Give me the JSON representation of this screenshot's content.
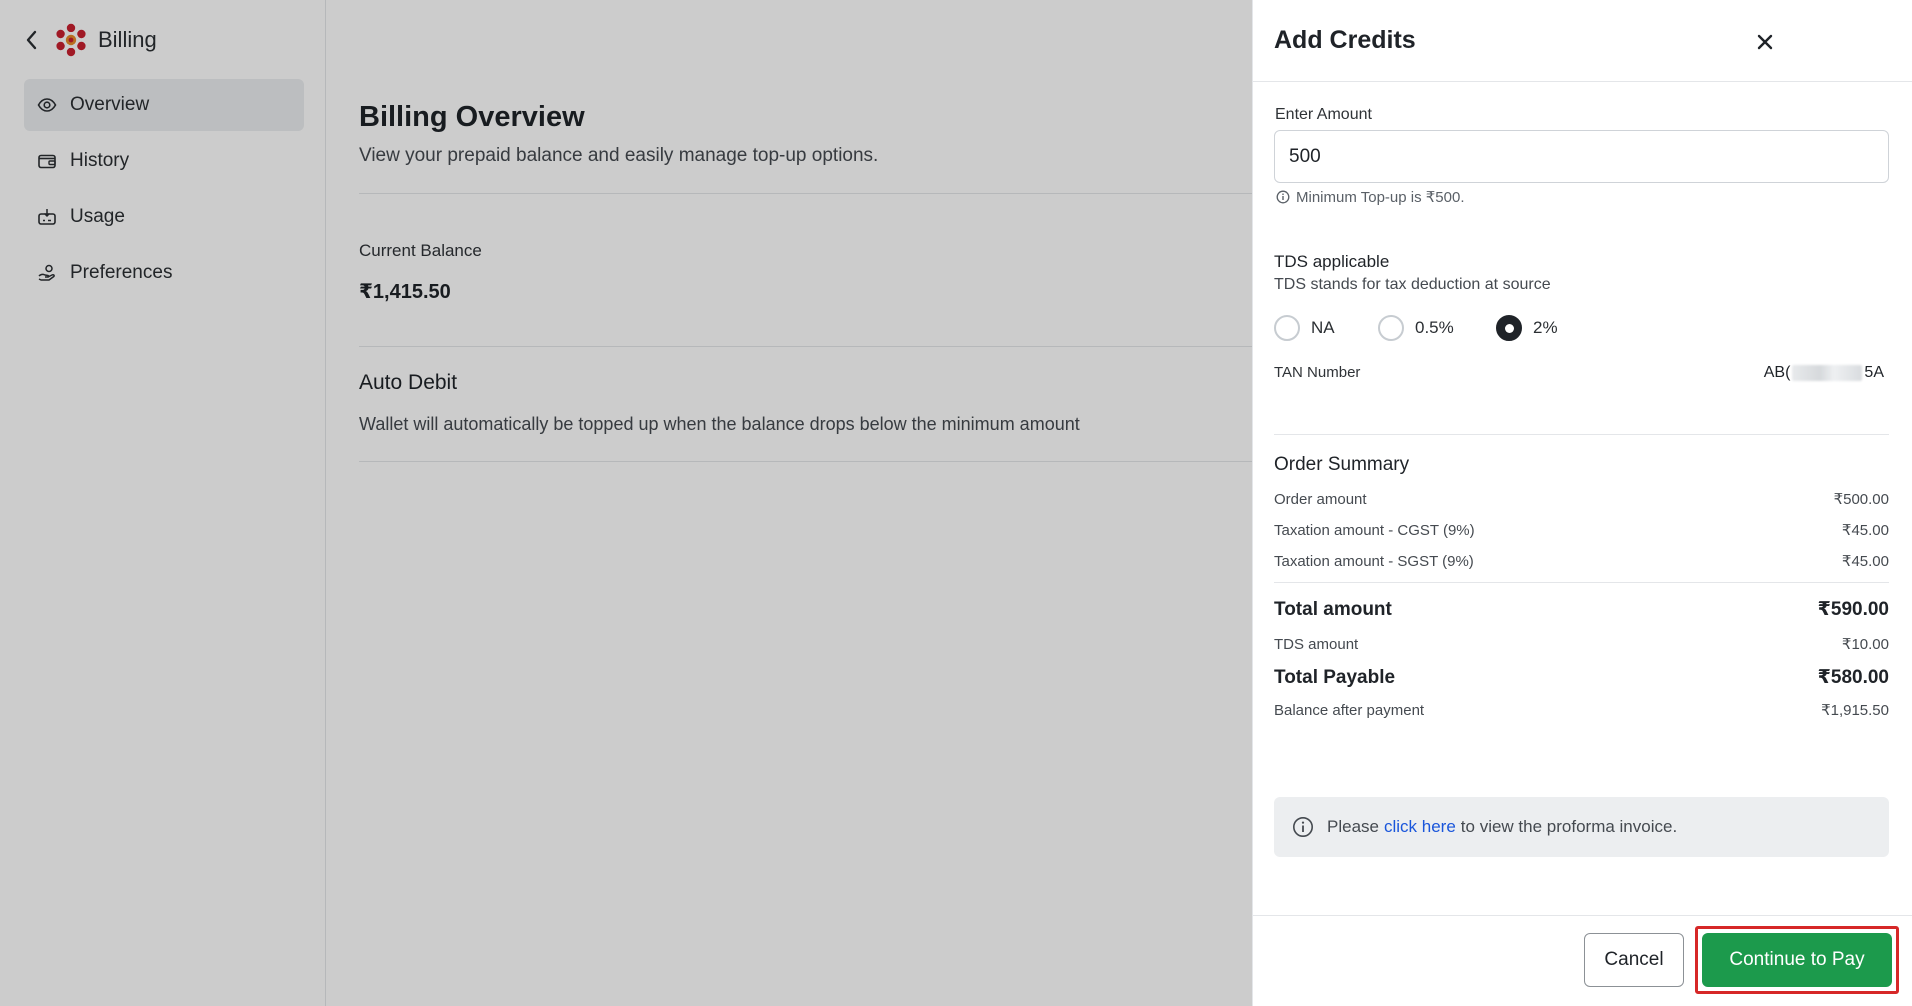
{
  "sidebar": {
    "title": "Billing",
    "items": [
      {
        "label": "Overview",
        "icon": "eye-icon",
        "active": true
      },
      {
        "label": "History",
        "icon": "wallet-icon",
        "active": false
      },
      {
        "label": "Usage",
        "icon": "chart-box-icon",
        "active": false
      },
      {
        "label": "Preferences",
        "icon": "coins-hand-icon",
        "active": false
      }
    ]
  },
  "main": {
    "title": "Billing Overview",
    "subtitle": "View your prepaid balance and easily manage top-up options.",
    "balance_label": "Current Balance",
    "balance_value": "₹1,415.50",
    "auto_debit_title": "Auto Debit",
    "auto_debit_desc": "Wallet will automatically be topped up when the balance drops below the minimum amount"
  },
  "drawer": {
    "title": "Add Credits",
    "amount_label": "Enter Amount",
    "amount_value": "500",
    "amount_hint": "Minimum Top-up is ₹500.",
    "tds_title": "TDS applicable",
    "tds_sub": "TDS stands for tax deduction at source",
    "tds_options": [
      {
        "label": "NA",
        "checked": false
      },
      {
        "label": "0.5%",
        "checked": false
      },
      {
        "label": "2%",
        "checked": true
      }
    ],
    "tan_label": "TAN Number",
    "tan_prefix": "AB(",
    "tan_suffix": "5A",
    "order_summary_title": "Order Summary",
    "order_amount_label": "Order amount",
    "order_amount_value": "₹500.00",
    "cgst_label": "Taxation amount - CGST (9%)",
    "cgst_value": "₹45.00",
    "sgst_label": "Taxation amount - SGST (9%)",
    "sgst_value": "₹45.00",
    "total_label": "Total amount",
    "total_value": "₹590.00",
    "tds_amount_label": "TDS amount",
    "tds_amount_value": "₹10.00",
    "payable_label": "Total Payable",
    "payable_value": "₹580.00",
    "balance_after_label": "Balance after payment",
    "balance_after_value": "₹1,915.50",
    "info_prefix": "Please",
    "info_link": "click here",
    "info_suffix": "to view the proforma invoice.",
    "cancel_label": "Cancel",
    "pay_label": "Continue to Pay"
  },
  "colors": {
    "accent_green": "#1c9a4c",
    "link_blue": "#1a56db",
    "highlight_red": "#d62828",
    "logo_red": "#c8202f"
  }
}
